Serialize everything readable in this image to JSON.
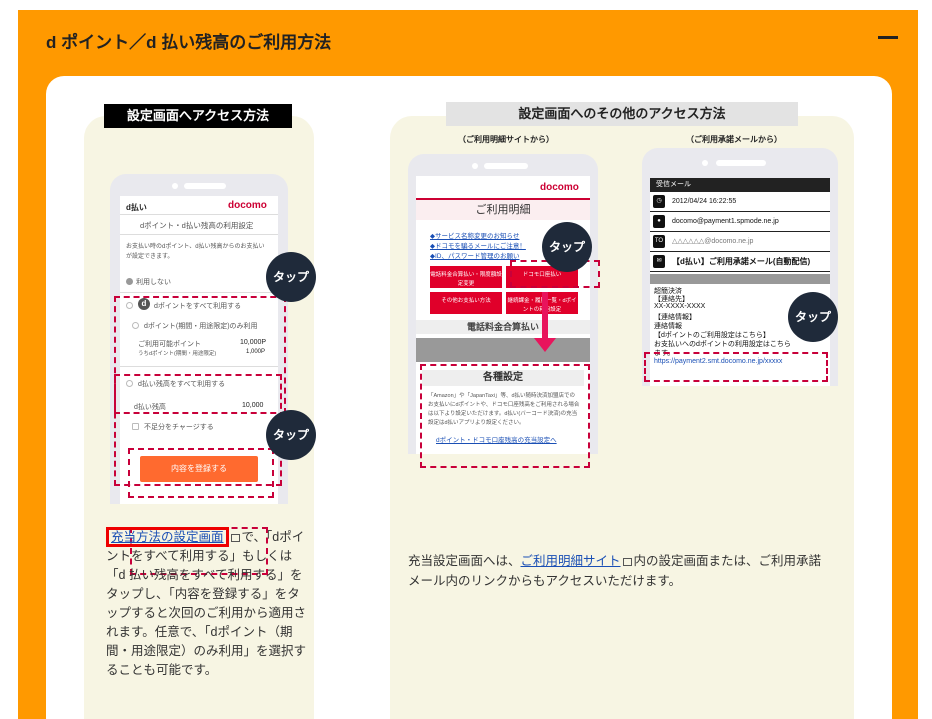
{
  "panel": {
    "title": "d ポイント／d 払い残高のご利用方法",
    "collapse_symbol": "—"
  },
  "left": {
    "label": "設定画面へアクセス方法",
    "phone": {
      "brand_left": "d払い",
      "brand_right": "docomo",
      "screen_title": "dポイント・d払い残高の利用設定",
      "intro": "お支払い時のdポイント、d払い残高からのお支払いが設定できます。",
      "option_off": "利用しない",
      "option_all_points": "dポイントをすべて利用する",
      "option_limited_points": "dポイント(期間・用途限定)のみ利用",
      "available_points_label": "ご利用可能ポイント",
      "available_points_value": "10,000P",
      "limited_points_label": "うちdポイント(期間・用途限定)",
      "limited_points_value": "1,000P",
      "option_all_balance": "d払い残高をすべて利用する",
      "balance_label": "d払い残高",
      "balance_value": "10,000",
      "charge_shortage": "不足分をチャージする",
      "register_button": "内容を登録する",
      "tap_1": "タップ",
      "tap_2": "タップ"
    },
    "caption_link": "充当方法の設定画面",
    "caption_text": "で、「dポイントをすべて利用する」もしくは「d 払い残高をすべて利用する」をタップし、「内容を登録する」をタップすると次回のご利用から適用されます。任意で、「dポイント（期間・用途限定）のみ利用」を選択することも可能です。"
  },
  "right": {
    "label": "設定画面へのその他のアクセス方法",
    "sub_left": "（ご利用明細サイトから）",
    "sub_right": "（ご利用承諾メールから）",
    "mid_phone": {
      "brand": "docomo",
      "title": "ご利用明細",
      "link_1": "◆サービス名称変更のお知らせ",
      "link_2": "◆ドコモを騙るメールにご注意！",
      "link_3": "◆ID、パスワード管理のお願い",
      "btn_1": "電話料金合算払い・限度額設定変更",
      "btn_2": "ドコモ口座払い",
      "btn_3": "その他お支払い方法",
      "btn_4": "継続課金・履歴一覧・dポイントの利用設定",
      "section_1": "電話料金合算払い",
      "section_2": "各種設定",
      "desc": "「Amazon」や「JapanTaxi」等、d払い随時決済加盟店でのお支払いにdポイントや、ドコモ口座残高をご利用される場合は以下より設定いただけます。d払い(バーコード決済)の充当設定はd払いアプリより設定ください。",
      "bottom_link": "dポイント・ドコモ口座残高の充当設定へ",
      "tap": "タップ"
    },
    "mail_phone": {
      "header": "受信メール",
      "datetime": "2012/04/24 16:22:55",
      "from": "docomo@payment1.spmode.ne.jp",
      "to_label": "TO",
      "to": "△△△△△△@docomo.ne.jp",
      "subject": "【d払い】ご利用承諾メール(自動配信)",
      "body_1": "超簡決済",
      "body_2": "【連絡先】",
      "body_3": "XX-XXXX-XXXX",
      "body_4": "【連絡情報】",
      "body_5": "連絡情報",
      "body_6": "【dポイントのご利用設定はこちら】",
      "body_7": "お支払いへのdポイントの利用設定はこちら",
      "body_8": "ます。",
      "url": "https://payment2.smt.docomo.ne.jp/xxxxx",
      "tap": "タップ"
    },
    "caption_before": "充当設定画面へは、",
    "caption_link": "ご利用明細サイト",
    "caption_after": "内の設定画面または、ご利用承諾メール内のリンクからもアクセスいただけます。"
  }
}
